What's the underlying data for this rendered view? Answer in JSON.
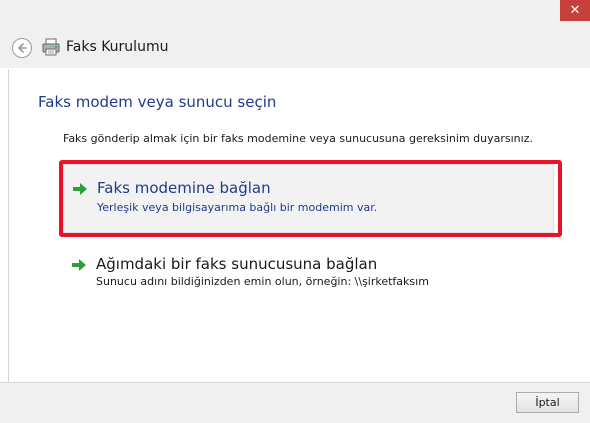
{
  "window": {
    "close_glyph": "✕",
    "app_title": "Faks Kurulumu"
  },
  "page": {
    "title": "Faks modem veya sunucu seçin",
    "description": "Faks gönderip almak için bir faks modemine veya sunucusuna gereksinim duyarsınız."
  },
  "options": [
    {
      "title": "Faks modemine bağlan",
      "subtitle": "Yerleşik veya bilgisayarıma bağlı bir modemim var.",
      "selected": true
    },
    {
      "title": "Ağımdaki bir faks sunucusuna bağlan",
      "subtitle": "Sunucu adını bildiğinizden emin olun, örneğin: \\\\şirketfaksım",
      "selected": false
    }
  ],
  "footer": {
    "cancel_label": "İptal"
  },
  "colors": {
    "accent_title": "#1f3b8a",
    "highlight_border": "#e5142a",
    "arrow_green": "#2e9e3a",
    "close_red": "#c7413c"
  },
  "icons": {
    "back": "back-arrow-icon",
    "app": "fax-printer-icon",
    "option_arrow": "green-arrow-icon",
    "close": "close-icon"
  }
}
